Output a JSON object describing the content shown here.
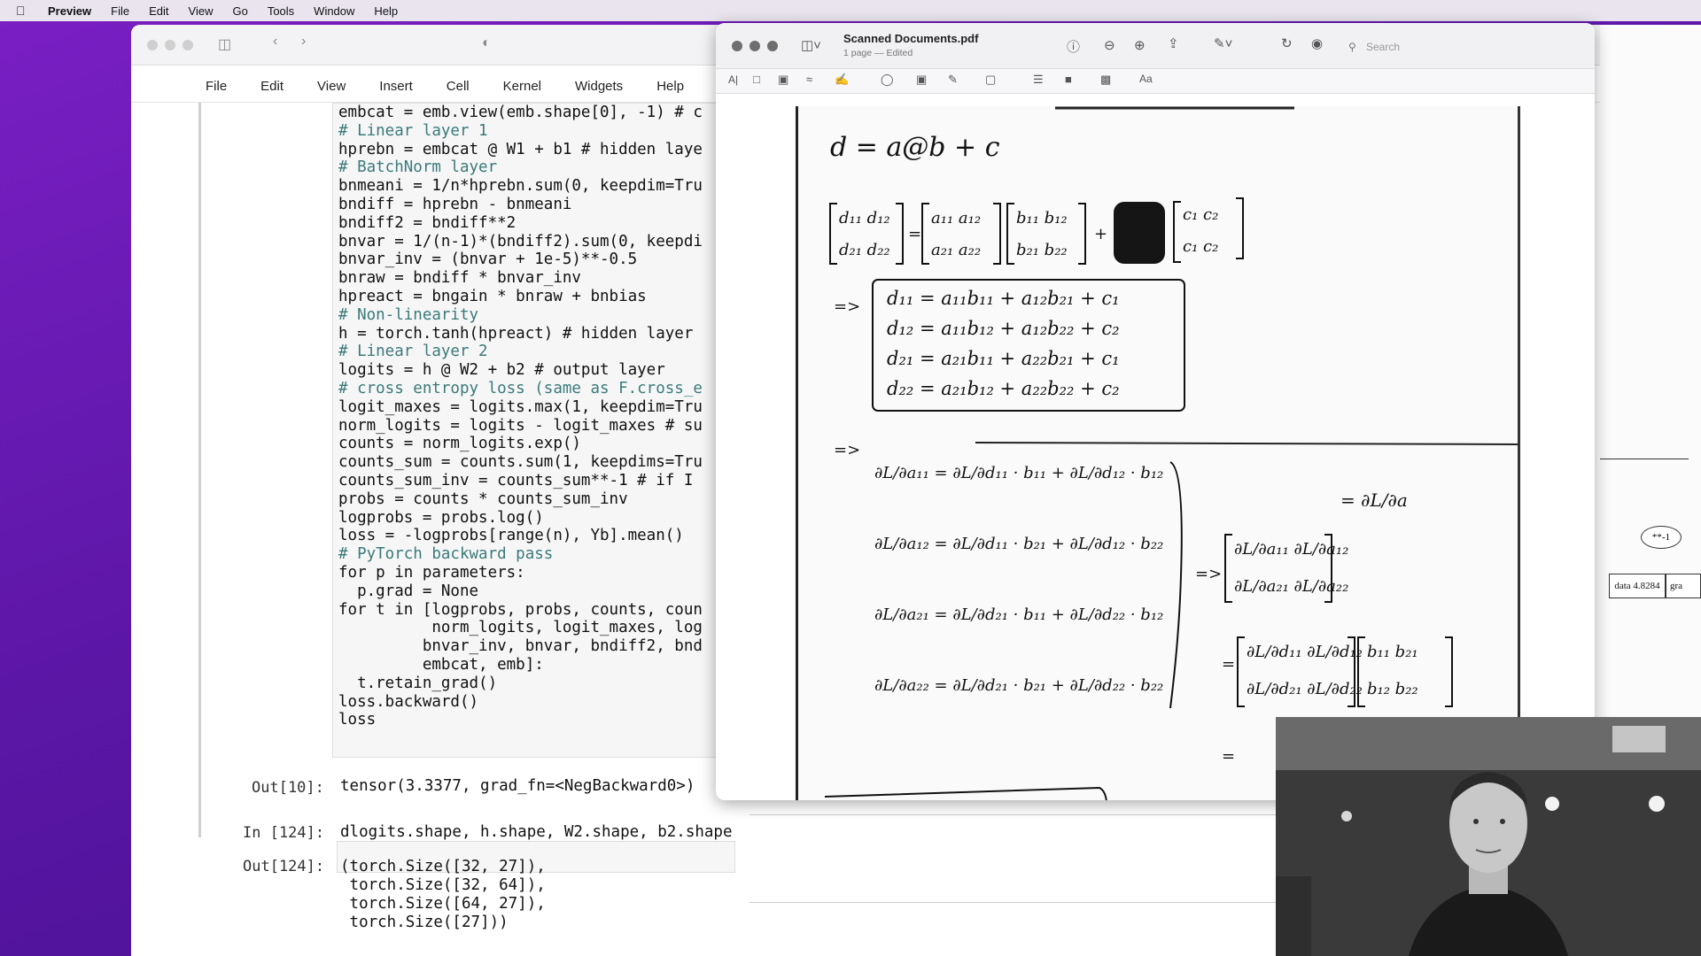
{
  "menubar": {
    "app": "Preview",
    "items": [
      "File",
      "Edit",
      "View",
      "Go",
      "Tools",
      "Window",
      "Help"
    ]
  },
  "jupyter": {
    "menu": [
      "File",
      "Edit",
      "View",
      "Insert",
      "Cell",
      "Kernel",
      "Widgets",
      "Help"
    ],
    "code_lines": [
      "embcat = emb.view(emb.shape[0], -1) # c",
      "# Linear layer 1",
      "hprebn = embcat @ W1 + b1 # hidden laye",
      "# BatchNorm layer",
      "bnmeani = 1/n*hprebn.sum(0, keepdim=Tru",
      "bndiff = hprebn - bnmeani",
      "bndiff2 = bndiff**2",
      "bnvar = 1/(n-1)*(bndiff2).sum(0, keepdi",
      "bnvar_inv = (bnvar + 1e-5)**-0.5",
      "bnraw = bndiff * bnvar_inv",
      "hpreact = bngain * bnraw + bnbias",
      "# Non-linearity",
      "h = torch.tanh(hpreact) # hidden layer",
      "# Linear layer 2",
      "logits = h @ W2 + b2 # output layer",
      "# cross entropy loss (same as F.cross_e",
      "logit_maxes = logits.max(1, keepdim=Tru",
      "norm_logits = logits - logit_maxes # su",
      "counts = norm_logits.exp()",
      "counts_sum = counts.sum(1, keepdims=Tru",
      "counts_sum_inv = counts_sum**-1 # if I",
      "probs = counts * counts_sum_inv",
      "logprobs = probs.log()",
      "loss = -logprobs[range(n), Yb].mean()",
      "",
      "# PyTorch backward pass",
      "for p in parameters:",
      "  p.grad = None",
      "for t in [logprobs, probs, counts, coun",
      "          norm_logits, logit_maxes, log",
      "         bnvar_inv, bnvar, bndiff2, bnd",
      "         embcat, emb]:",
      "  t.retain_grad()",
      "loss.backward()",
      "loss"
    ],
    "out10_label": "Out[10]:",
    "out10_text": "tensor(3.3377, grad_fn=<NegBackward0>)",
    "in124_label": "In [124]:",
    "in124_text": "dlogits.shape, h.shape, W2.shape, b2.shape",
    "out124_label": "Out[124]:",
    "out124_lines": [
      "(torch.Size([32, 27]),",
      " torch.Size([32, 64]),",
      " torch.Size([64, 27]),",
      " torch.Size([27]))"
    ]
  },
  "preview": {
    "title": "Scanned Documents.pdf",
    "subtitle": "1 page — Edited",
    "search_placeholder": "Search",
    "notes": {
      "eq1": "d = a@b + c",
      "row_d11": "d₁₁ = a₁₁b₁₁ + a₁₂b₂₁ + c₁",
      "row_d12": "d₁₂ = a₁₁b₁₂ + a₁₂b₂₂ + c₂",
      "row_d21": "d₂₁ = a₂₁b₁₁ + a₂₂b₂₁ + c₁",
      "row_d22": "d₂₂ = a₂₁b₁₂ + a₂₂b₂₂ + c₂",
      "implies": "=>",
      "dL_da": "= ∂L/∂a"
    }
  },
  "graph_node": {
    "op": "**-1",
    "data_label": "data 4.8284",
    "grad_label": "gra"
  }
}
